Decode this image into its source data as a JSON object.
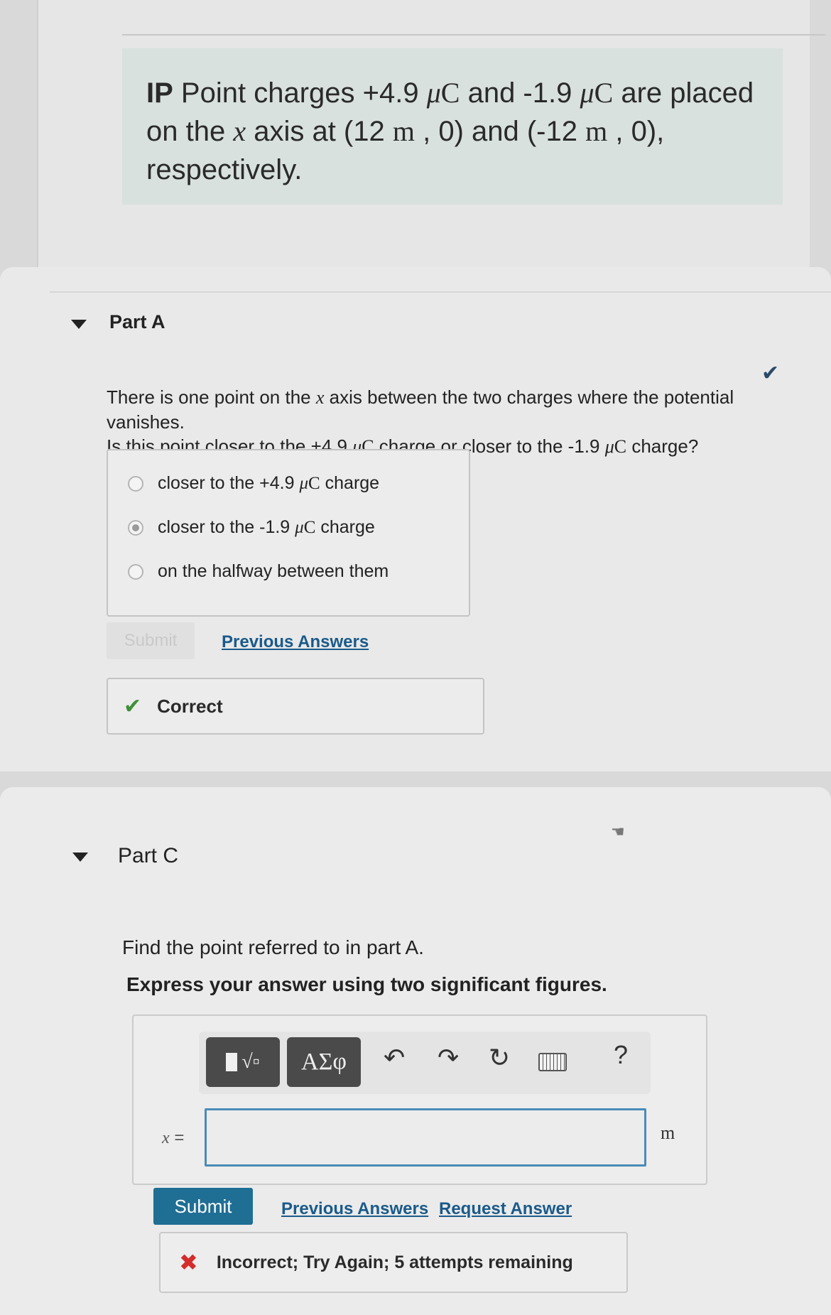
{
  "problem": {
    "prefix": "IP",
    "line1_a": " Point charges +4.9 ",
    "mu": "μ",
    "unit_C": "C",
    "line1_b": " and -1.9 ",
    "line1_c": " are placed",
    "line2_a": "on the ",
    "x_var": "x",
    "line2_b": " axis at (12 ",
    "unit_m": "m",
    "line2_c": " , 0) and (-12 ",
    "line2_d": " , 0),",
    "line3": "respectively."
  },
  "part_a": {
    "title": "Part A",
    "question_line1_a": "There is one point on the ",
    "question_line1_b": " axis between the two charges where the potential vanishes.",
    "question_line2_a": "Is this point closer to the +4.9 ",
    "question_line2_b": " charge or closer to the -1.9 ",
    "question_line2_c": " charge?",
    "options": [
      {
        "prefix": "closer to the +4.9 ",
        "suffix": " charge",
        "selected": false
      },
      {
        "prefix": "closer to the -1.9 ",
        "suffix": " charge",
        "selected": true
      },
      {
        "label": "on the halfway between them",
        "selected": false
      }
    ],
    "submit_label": "Submit",
    "previous_answers_label": "Previous Answers",
    "feedback": "Correct",
    "status_color": "#3f8f3a"
  },
  "part_c": {
    "title": "Part C",
    "instruction": "Find the point referred to in part A.",
    "express": "Express your answer using two significant figures.",
    "toolbar": {
      "greek_label": "ΑΣφ",
      "help_label": "?"
    },
    "answer_var": "x",
    "answer_eq": " =",
    "answer_value": "",
    "unit": "m",
    "submit_label": "Submit",
    "previous_answers_label": "Previous Answers",
    "request_answer_label": "Request Answer",
    "feedback": "Incorrect; Try Again; 5 attempts remaining",
    "status_color": "#d42c2c",
    "accent_color": "#1f6e94"
  }
}
